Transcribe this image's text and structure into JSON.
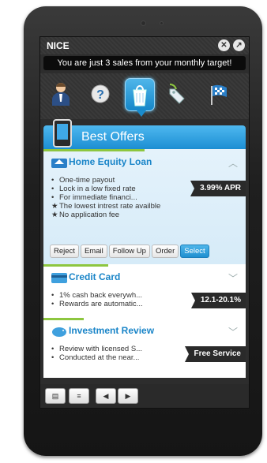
{
  "app": {
    "title": "NICE",
    "banner": "You are just 3 sales from your monthly target!"
  },
  "toolbar": {
    "tools": [
      "agent-icon",
      "help-icon",
      "offers-icon",
      "tag-icon",
      "finish-flag-icon"
    ],
    "selected": 2
  },
  "section": {
    "title": "Best Offers"
  },
  "offers": [
    {
      "title": "Home Equity Loan",
      "rate": "3.99% APR",
      "progress": 0.5,
      "bullets": [
        {
          "mark": "•",
          "text": "One-time payout"
        },
        {
          "mark": "•",
          "text": "Lock in a low fixed rate"
        },
        {
          "mark": "•",
          "text": "For immediate financi..."
        },
        {
          "mark": "★",
          "text": "The lowest intrest rate availble"
        },
        {
          "mark": "★",
          "text": "No application fee"
        }
      ],
      "actions": [
        "Reject",
        "Email",
        "Follow Up",
        "Order",
        "Select"
      ]
    },
    {
      "title": "Credit Card",
      "rate": "12.1-20.1%",
      "progress": 0.32,
      "bullets": [
        {
          "mark": "•",
          "text": "1% cash back everywh..."
        },
        {
          "mark": "•",
          "text": "Rewards are automatic..."
        }
      ]
    },
    {
      "title": "Investment Review",
      "rate": "Free Service",
      "progress": 0.2,
      "bullets": [
        {
          "mark": "•",
          "text": "Review with licensed S..."
        },
        {
          "mark": "•",
          "text": "Conducted at the near..."
        }
      ]
    }
  ],
  "colors": {
    "accent": "#1f8fd0",
    "progress": "#8dc63f"
  }
}
